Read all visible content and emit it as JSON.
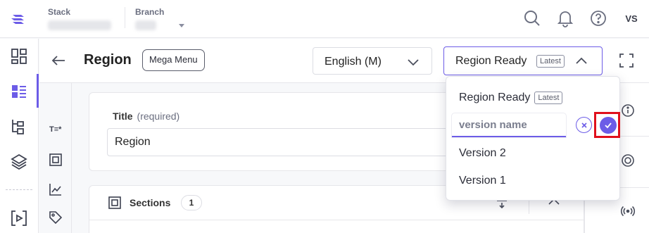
{
  "topbar": {
    "stack_label": "Stack",
    "branch_label": "Branch",
    "avatar_initials": "VS"
  },
  "entry": {
    "title": "Region",
    "content_type": "Mega Menu",
    "locale": "English (M)",
    "version_selected": "Region Ready",
    "version_badge": "Latest"
  },
  "form": {
    "title_label": "Title",
    "title_hint": "(required)",
    "title_value": "Region",
    "sections_label": "Sections",
    "sections_count": "1",
    "toolbar_text_icon": "T≡*"
  },
  "version_dropdown": {
    "current": "Region Ready",
    "current_badge": "Latest",
    "name_placeholder": "version name",
    "items": [
      "Version 2",
      "Version 1"
    ]
  },
  "colors": {
    "accent": "#6c5ce7",
    "highlight": "#e0101c"
  }
}
